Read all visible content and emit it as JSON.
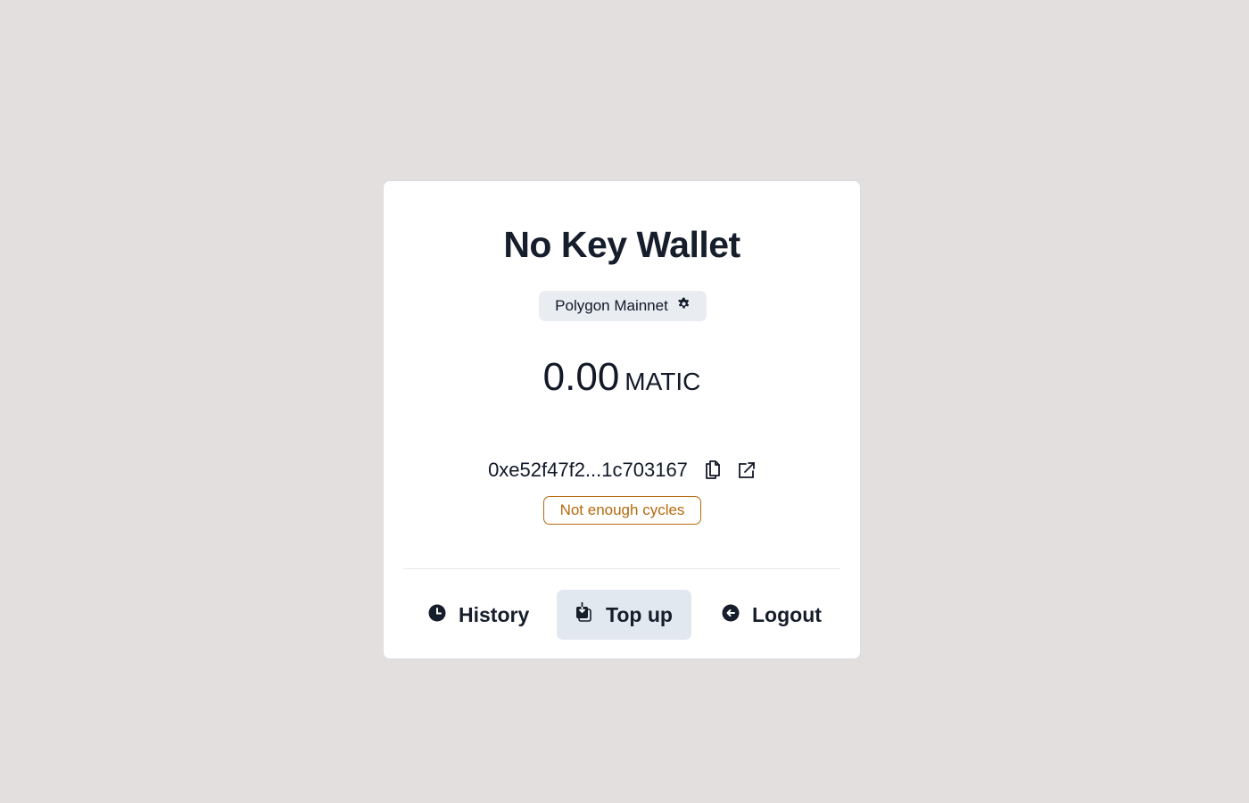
{
  "wallet": {
    "title": "No Key Wallet",
    "network": "Polygon Mainnet",
    "balance_amount": "0.00",
    "balance_currency": "MATIC",
    "address": "0xe52f47f2...1c703167",
    "status_badge": "Not enough cycles"
  },
  "actions": {
    "history": "History",
    "top_up": "Top up",
    "logout": "Logout"
  },
  "colors": {
    "background": "#e3dfde",
    "warning": "#b7690f",
    "chip": "#e9edf2",
    "primary_button": "#e2e8f0"
  }
}
